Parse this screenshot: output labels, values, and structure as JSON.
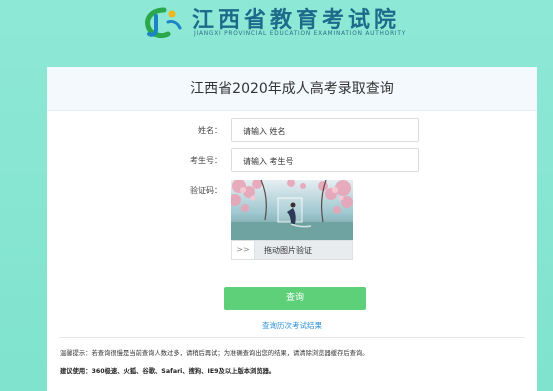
{
  "header": {
    "logo_cn": "江西省教育考试院",
    "logo_en": "JIANGXI PROVINCIAL EDUCATION EXAMINATION AUTHORITY"
  },
  "form": {
    "title": "江西省2020年成人高考录取查询",
    "name_label": "姓名：",
    "name_placeholder": "请输入 姓名",
    "exam_no_label": "考生号：",
    "exam_no_placeholder": "请输入 考生号",
    "captcha_label": "验证码：",
    "slider_handle": ">>",
    "slider_text": "拖动图片验证",
    "submit_label": "查询",
    "history_link": "查询历次考试结果",
    "tip_text": "温馨提示：若查询很慢是当前查询人数过多，请稍后再试；为准确查询出您的结果，请清除浏览器缓存后查询。",
    "suggest_text": "建议使用：360极速、火狐、谷歌、Safari、搜狗、IE9及以上版本浏览器。"
  },
  "colors": {
    "background": "#7fe3cd",
    "button": "#5fd07a",
    "link": "#2a8fd6"
  }
}
